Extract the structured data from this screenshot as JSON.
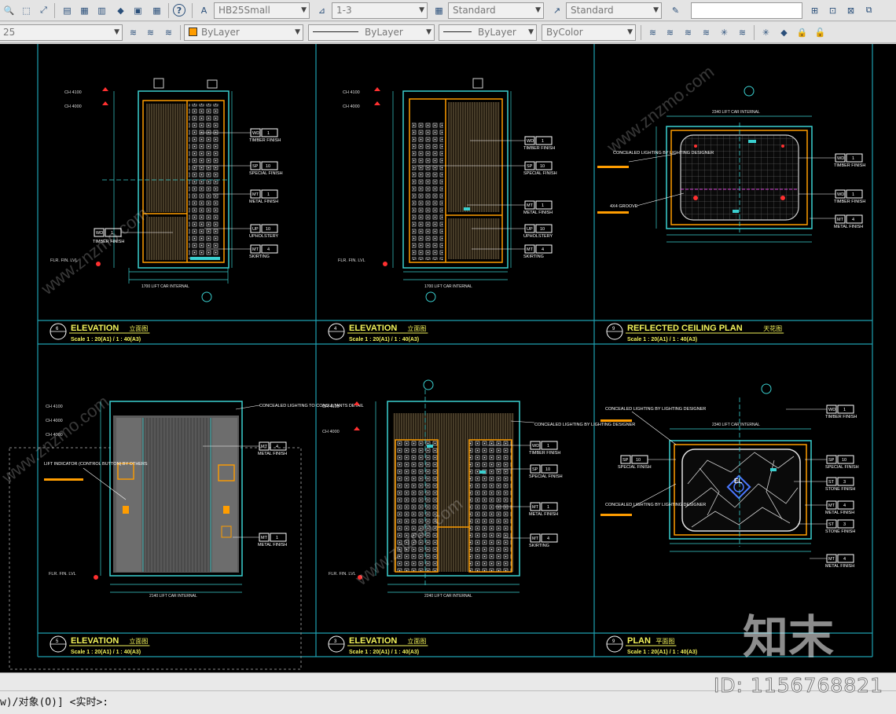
{
  "toolbar1": {
    "text_style": "HB25Small",
    "scale_value": "1-3",
    "table_style": "Standard",
    "mleader_style": "Standard",
    "search_value": ""
  },
  "toolbar2": {
    "layer_value": "25",
    "color_value": "ByLayer",
    "linetype_value": "ByLayer",
    "lineweight_value": "ByLayer",
    "plotstyle_value": "ByColor"
  },
  "panels": [
    {
      "num": "6",
      "title": "ELEVATION",
      "cn": "立面图",
      "scale": "Scale 1 : 20(A1) / 1 : 40(A3)"
    },
    {
      "num": "4",
      "title": "ELEVATION",
      "cn": "立面图",
      "scale": "Scale 1 : 20(A1) / 1 : 40(A3)"
    },
    {
      "num": "9",
      "title": "REFLECTED CEILING PLAN",
      "cn": "天花图",
      "scale": "Scale 1 : 20(A1) / 1 : 40(A3)"
    },
    {
      "num": "5",
      "title": "ELEVATION",
      "cn": "立面图",
      "scale": "Scale 1 : 20(A1) / 1 : 40(A3)"
    },
    {
      "num": "3",
      "title": "ELEVATION",
      "cn": "立面图",
      "scale": "Scale 1 : 20(A1) / 1 : 40(A3)"
    },
    {
      "num": "9",
      "title": "PLAN",
      "cn": "平面图",
      "scale": "Scale 1 : 20(A1) / 1 : 40(A3)"
    }
  ],
  "labels": {
    "ch1": "CH 4100",
    "ch2": "CH 4000",
    "fin_lvl": "FLR. FIN. LVL",
    "lift_car_1": "1700 LIFT CAR INTERNAL",
    "lift_car_2": "1700 LIFT CAR INTERNAL",
    "lift_car_3": "2140 LIFT CAR INTERNAL",
    "lift_car_4": "2240 LIFT CAR INTERNAL",
    "rcp_top": "2340 LIFT CAR INTERNAL",
    "plan_top": "2340 LIFT CAR INTERNAL",
    "timber_finish": "TIMBER FINISH",
    "special_finish": "SPECIAL FINISH",
    "metal_finish": "METAL FINISH",
    "upholstery": "UPHOLSTERY",
    "skirting": "SKIRTING",
    "stone_finish": "STONE FINISH",
    "concealed_lighting": "CONCEALED LIGHTING BY LIGHTING DESIGNER",
    "groove": "4X4 GROOVE",
    "lift_indicator": "LIFT INDICATOR (CONTROL BUTTON) BY OTHERS",
    "concealed_conslt": "CONCEALED LIGHTING TO CONSULTANTS DETAIL",
    "el": "EL",
    "tag_wd": "WD",
    "tag_sp": "SP",
    "tag_mt": "MT",
    "tag_up": "UP",
    "tag_st": "ST",
    "n1": "1",
    "n10": "10",
    "n4": "4",
    "n3": "3"
  },
  "command": {
    "line": "w)/对象(O)] <实时>:"
  },
  "watermark": {
    "brand": "知末",
    "id_text": "ID: 1156768821",
    "site": "www.znzmo.com"
  },
  "colors": {
    "canvas_bg": "#000000",
    "frame": "#1f9fb0",
    "dim": "#3ad0d0",
    "title_yellow": "#f2f25a",
    "accent_orange": "#ff9d00",
    "magenta": "#ff3fff",
    "red": "#ff3030",
    "blue_tag": "#4a78ff"
  }
}
